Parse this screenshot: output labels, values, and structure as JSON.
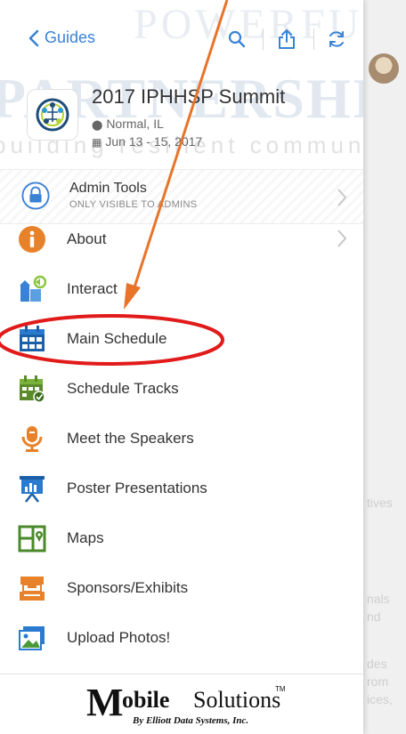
{
  "background": {
    "snippets": [
      "tives",
      "nals",
      "nd",
      "des",
      "rom",
      "ices,"
    ]
  },
  "watermark": {
    "line1": "POWERFUL",
    "line2": "PARTNERSHIPS",
    "line3": "building resilient communities"
  },
  "topbar": {
    "back_label": "Guides"
  },
  "event": {
    "title": "2017 IPHHSP Summit",
    "location": "Normal, IL",
    "dates": "Jun 13 - 15, 2017"
  },
  "admin": {
    "label": "Admin Tools",
    "sublabel": "ONLY VISIBLE TO ADMINS"
  },
  "menu": {
    "items": [
      {
        "label": "About",
        "icon": "info-icon"
      },
      {
        "label": "Interact",
        "icon": "interact-icon"
      },
      {
        "label": "Main Schedule",
        "icon": "calendar-icon"
      },
      {
        "label": "Schedule Tracks",
        "icon": "schedule-tracks-icon"
      },
      {
        "label": "Meet the Speakers",
        "icon": "microphone-icon"
      },
      {
        "label": "Poster Presentations",
        "icon": "presentation-board-icon"
      },
      {
        "label": "Maps",
        "icon": "map-icon"
      },
      {
        "label": "Sponsors/Exhibits",
        "icon": "booth-icon"
      },
      {
        "label": "Upload Photos!",
        "icon": "photo-icon"
      }
    ]
  },
  "footer": {
    "brand_mark": "M",
    "brand_bold": "obile",
    "brand_rest": "Solutions",
    "trademark": "TM",
    "byline": "By Elliott Data Systems, Inc."
  },
  "colors": {
    "accent_blue": "#3a82d4",
    "annotation_red": "#e11a1a",
    "annotation_orange": "#e8742a"
  }
}
